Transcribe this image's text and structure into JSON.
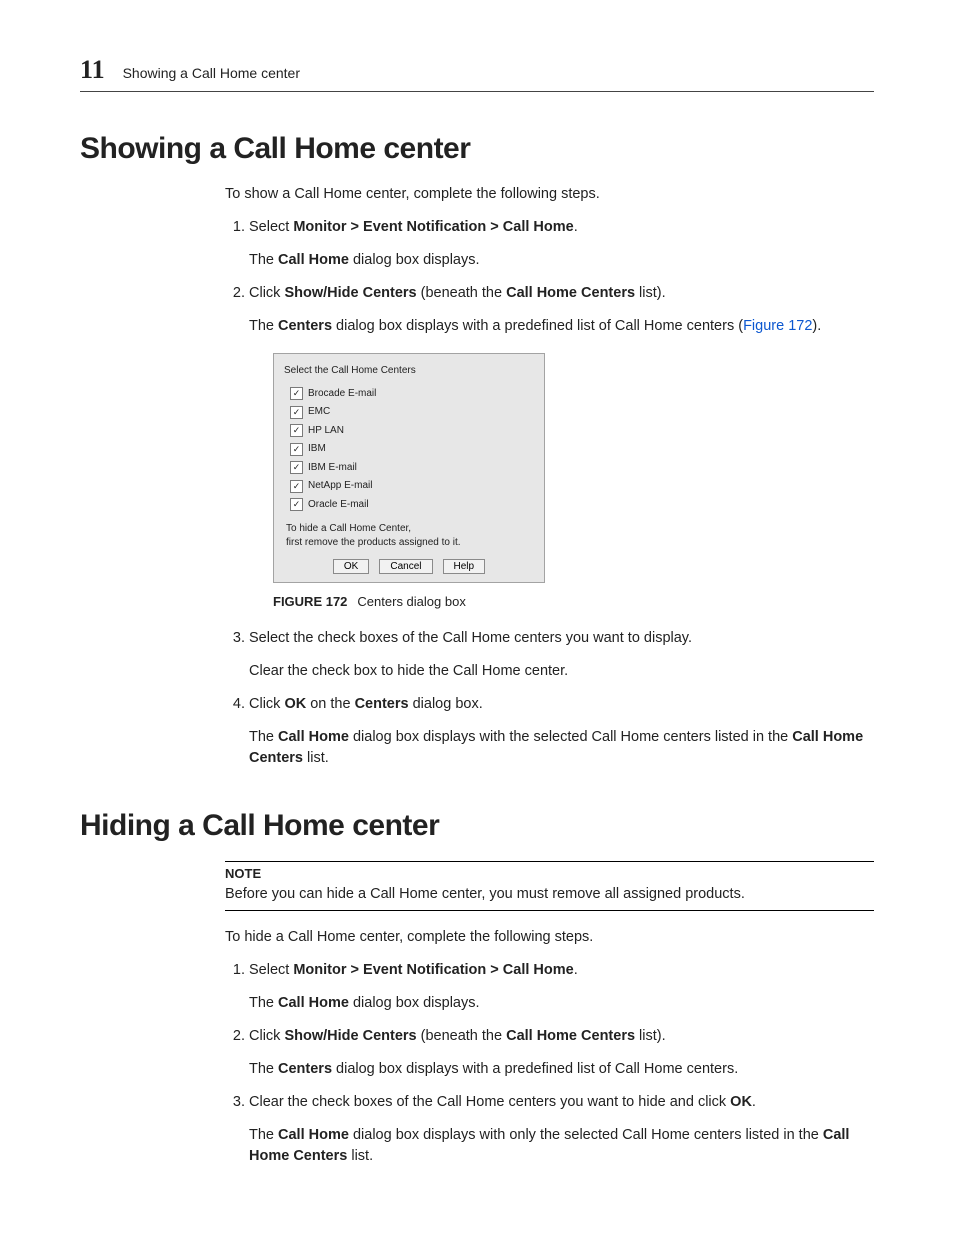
{
  "header": {
    "chapter_num": "11",
    "chapter_title": "Showing a Call Home center"
  },
  "h1a": "Showing a Call Home center",
  "intro_a": "To show a Call Home center, complete the following steps.",
  "steps_a": {
    "s1": {
      "pre": "Select ",
      "bold": "Monitor > Event Notification > Call Home",
      "post": ".",
      "r_pre": "The ",
      "r_bold": "Call Home",
      "r_post": " dialog box displays."
    },
    "s2": {
      "pre": "Click ",
      "b1": "Show/Hide Centers",
      "mid": " (beneath the ",
      "b2": "Call Home Centers",
      "post": " list).",
      "r_pre": "The ",
      "r_b": "Centers",
      "r_mid": " dialog box displays with a predefined list of Call Home centers (",
      "r_link": "Figure 172",
      "r_post": ")."
    },
    "s3": {
      "line": "Select the check boxes of the Call Home centers you want to display.",
      "r": "Clear the check box to hide the Call Home center."
    },
    "s4": {
      "pre": "Click ",
      "b1": "OK",
      "mid": " on the ",
      "b2": "Centers",
      "post": " dialog box.",
      "r_pre": "The ",
      "r_b1": "Call Home",
      "r_mid": " dialog box displays with the selected Call Home centers listed in the ",
      "r_b2": "Call Home Centers",
      "r_post": " list."
    }
  },
  "dialog": {
    "title": "Select the Call Home Centers",
    "items": [
      "Brocade E-mail",
      "EMC",
      "HP LAN",
      "IBM",
      "IBM E-mail",
      "NetApp E-mail",
      "Oracle E-mail"
    ],
    "note_line1": "To hide a Call Home Center,",
    "note_line2": "first remove the products assigned to it.",
    "btn_ok": "OK",
    "btn_cancel": "Cancel",
    "btn_help": "Help"
  },
  "fig": {
    "label": "FIGURE 172",
    "caption": "Centers dialog box"
  },
  "h1b": "Hiding a Call Home center",
  "note": {
    "title": "NOTE",
    "text": "Before you can hide a Call Home center, you must remove all assigned products."
  },
  "intro_b": "To hide a Call Home center, complete the following steps.",
  "steps_b": {
    "s1": {
      "pre": "Select ",
      "bold": "Monitor > Event Notification > Call Home",
      "post": ".",
      "r_pre": "The ",
      "r_bold": "Call Home",
      "r_post": " dialog box displays."
    },
    "s2": {
      "pre": "Click ",
      "b1": "Show/Hide Centers",
      "mid": " (beneath the ",
      "b2": "Call Home Centers",
      "post": " list).",
      "r_pre": "The ",
      "r_b": "Centers",
      "r_post": " dialog box displays with a predefined list of Call Home centers."
    },
    "s3": {
      "pre": "Clear the check boxes of the Call Home centers you want to hide and click ",
      "b": "OK",
      "post": ".",
      "r_pre": "The ",
      "r_b1": "Call Home",
      "r_mid": " dialog box displays with only the selected Call Home centers listed in the ",
      "r_b2": "Call Home Centers",
      "r_post": " list."
    }
  }
}
